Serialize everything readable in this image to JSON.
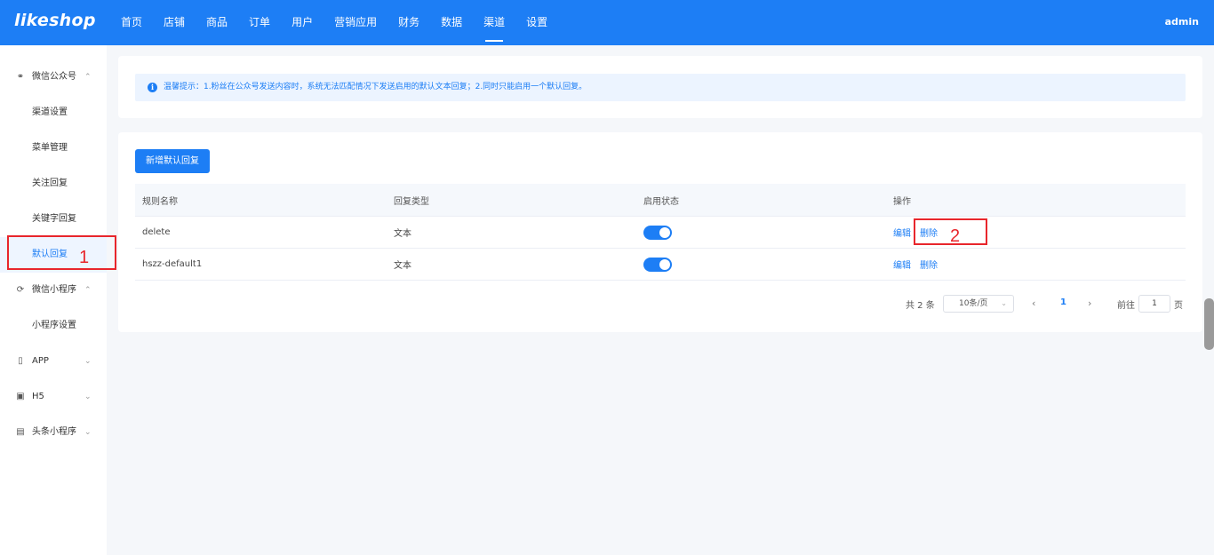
{
  "app": {
    "logo": "likeshop",
    "user": "admin"
  },
  "nav": [
    {
      "label": "首页"
    },
    {
      "label": "店铺"
    },
    {
      "label": "商品"
    },
    {
      "label": "订单"
    },
    {
      "label": "用户"
    },
    {
      "label": "营销应用"
    },
    {
      "label": "财务"
    },
    {
      "label": "数据"
    },
    {
      "label": "渠道",
      "active": true
    },
    {
      "label": "设置"
    }
  ],
  "sidebar": {
    "wechat_oa": {
      "label": "微信公众号",
      "icon": "wechat-icon",
      "items": [
        "渠道设置",
        "菜单管理",
        "关注回复",
        "关键字回复",
        "默认回复"
      ]
    },
    "mini_program": {
      "label": "微信小程序",
      "icon": "mini-program-icon",
      "items": [
        "小程序设置"
      ]
    },
    "app": {
      "label": "APP",
      "icon": "phone-icon"
    },
    "h5": {
      "label": "H5",
      "icon": "image-icon"
    },
    "toutiao": {
      "label": "头条小程序",
      "icon": "document-icon"
    }
  },
  "tip": {
    "text": "温馨提示：1.粉丝在公众号发送内容时，系统无法匹配情况下发送启用的默认文本回复；2.同时只能启用一个默认回复。"
  },
  "toolbar": {
    "add_label": "新增默认回复"
  },
  "table": {
    "headers": [
      "规则名称",
      "回复类型",
      "启用状态",
      "操作"
    ],
    "rows": [
      {
        "name": "delete",
        "type": "文本",
        "enabled": true,
        "edit": "编辑",
        "delete": "删除"
      },
      {
        "name": "hszz-default1",
        "type": "文本",
        "enabled": true,
        "edit": "编辑",
        "delete": "删除"
      }
    ]
  },
  "pagination": {
    "total": "共 2 条",
    "page_size": "10条/页",
    "current_page": "1",
    "goto_label": "前往",
    "goto_value": "1",
    "page_suffix": "页"
  },
  "annotations": {
    "step1": "1",
    "step2": "2"
  },
  "colors": {
    "primary": "#1d7ef5",
    "annotation": "#e8262c"
  }
}
